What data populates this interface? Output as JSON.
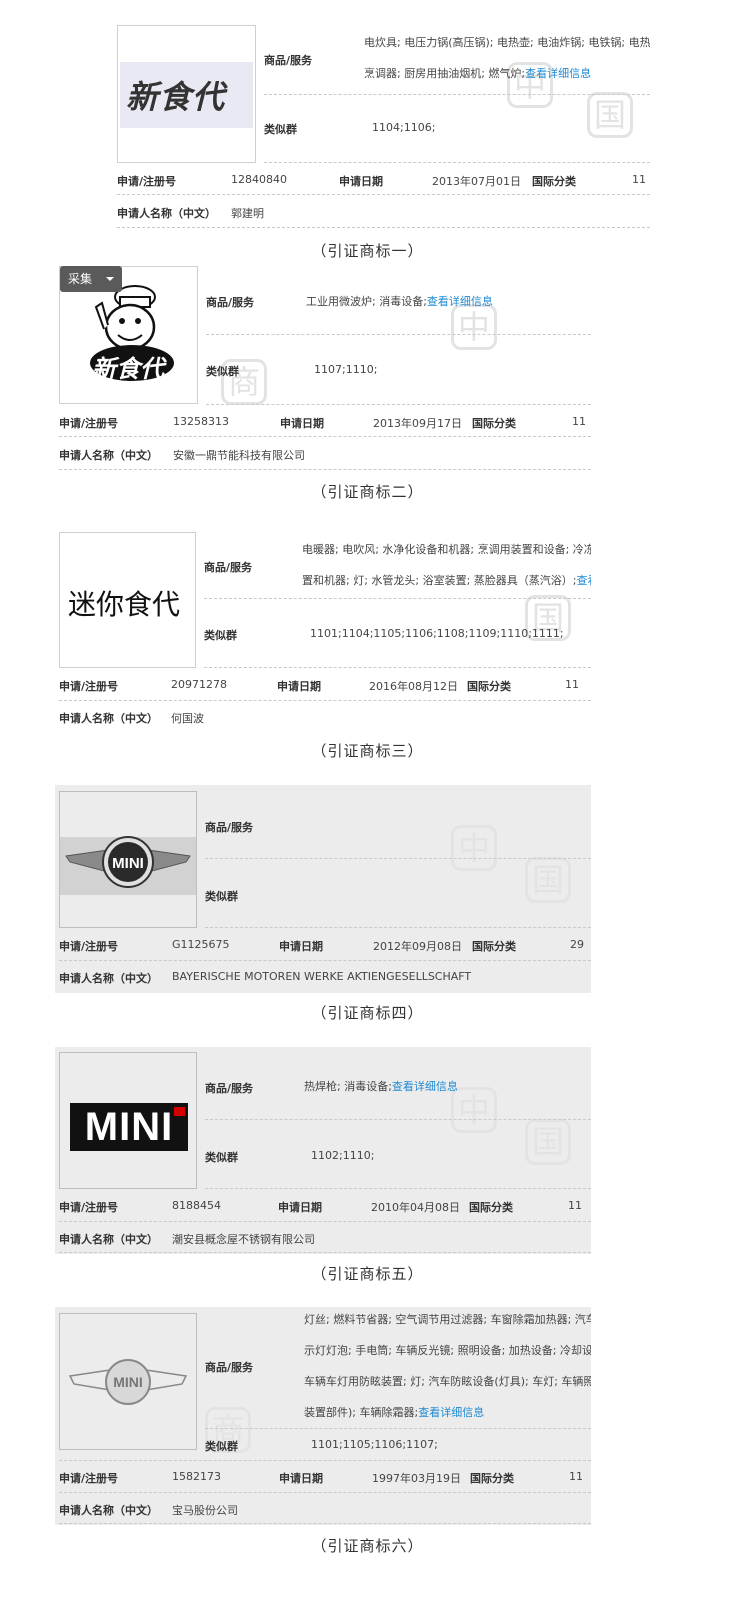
{
  "collect_button": "采集",
  "labels": {
    "goods": "商品/服务",
    "similar": "类似群",
    "reg_no": "申请/注册号",
    "app_date": "申请日期",
    "intl_class": "国际分类",
    "applicant": "申请人名称（中文）",
    "detail_link": "查看详细信息"
  },
  "marks": [
    {
      "logo_text": "新食代",
      "goods_lines": [
        "电炊具; 电压力锅(高压锅); 电热壶; 电油炸锅; 电铁锅; 电热",
        "烹调器; 厨房用抽油烟机; 燃气炉;"
      ],
      "similar": "1104;1106;",
      "reg_no": "12840840",
      "app_date": "2013年07月01日",
      "intl_class": "11",
      "applicant": "郭建明",
      "caption": "（引证商标一）"
    },
    {
      "logo_text": "新食代",
      "goods_lines": [
        "工业用微波炉; 消毒设备;"
      ],
      "similar": "1107;1110;",
      "reg_no": "13258313",
      "app_date": "2013年09月17日",
      "intl_class": "11",
      "applicant": "安徽一鼎节能科技有限公司",
      "caption": "（引证商标二）"
    },
    {
      "logo_text": "迷你食代",
      "goods_lines": [
        "电暖器; 电吹风; 水净化设备和机器; 烹调用装置和设备; 冷冻",
        "置和机器; 灯; 水管龙头; 浴室装置; 蒸脸器具（蒸汽浴）;"
      ],
      "detail_link_short": "查看",
      "similar": "1101;1104;1105;1106;1108;1109;1110;1111;",
      "reg_no": "20971278",
      "app_date": "2016年08月12日",
      "intl_class": "11",
      "applicant": "何国波",
      "caption": "（引证商标三）"
    },
    {
      "logo_text": "MINI",
      "goods_lines": [],
      "similar": "",
      "reg_no": "G1125675",
      "app_date": "2012年09月08日",
      "intl_class": "29",
      "applicant": "BAYERISCHE MOTOREN WERKE AKTIENGESELLSCHAFT",
      "caption": "（引证商标四）"
    },
    {
      "logo_text": "MINI",
      "goods_lines": [
        "热焊枪; 消毒设备;"
      ],
      "similar": "1102;1110;",
      "reg_no": "8188454",
      "app_date": "2010年04月08日",
      "intl_class": "11",
      "applicant": "潮安县概念屋不锈钢有限公司",
      "caption": "（引证商标五）"
    },
    {
      "logo_text": "MINI",
      "goods_lines": [
        "灯丝; 燃料节省器; 空气调节用过滤器; 车窗除霜加热器; 汽车",
        "示灯灯泡; 手电筒; 车辆反光镜; 照明设备; 加热设备; 冷却设",
        "车辆车灯用防眩装置; 灯; 汽车防眩设备(灯具); 车灯; 车辆照",
        "装置部件); 车辆除霜器;"
      ],
      "similar": "1101;1105;1106;1107;",
      "reg_no": "1582173",
      "app_date": "1997年03月19日",
      "intl_class": "11",
      "applicant": "宝马股份公司",
      "caption": "（引证商标六）"
    }
  ]
}
